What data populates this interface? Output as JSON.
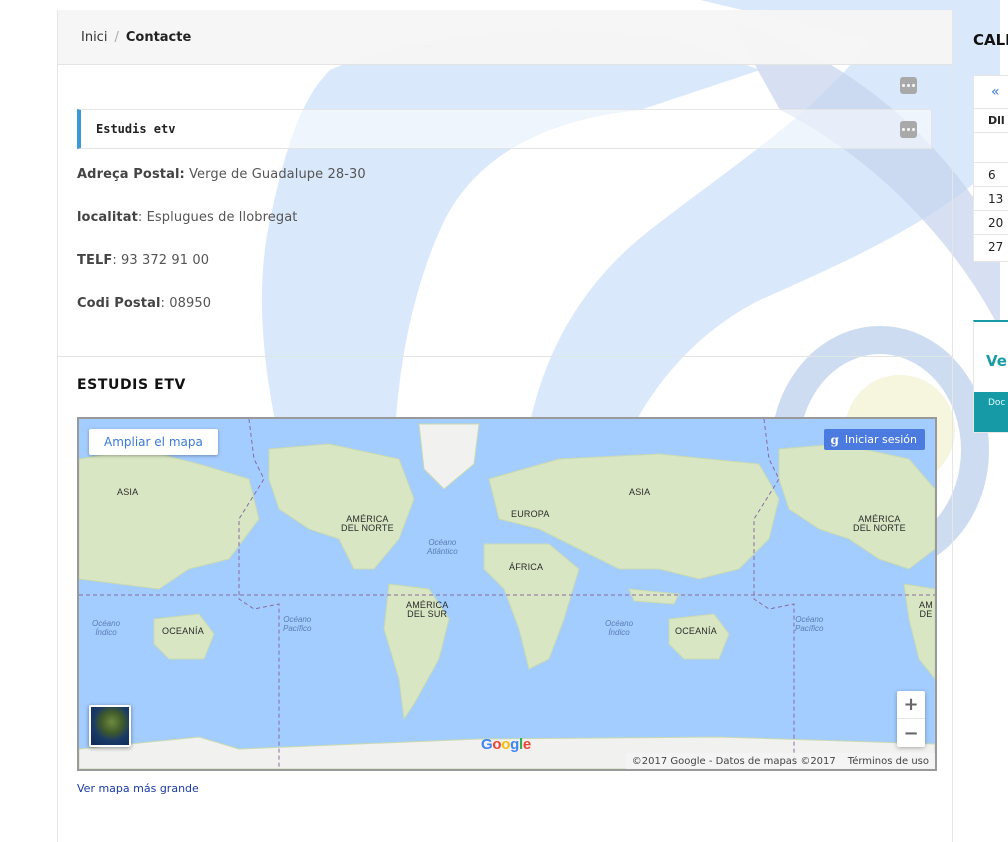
{
  "breadcrumb": {
    "home": "Inici",
    "separator": "/",
    "current": "Contacte"
  },
  "contact": {
    "name": "Estudis etv",
    "address_label": "Adreça Postal:",
    "address_value": "Verge de Guadalupe 28-30",
    "city_label": "localitat",
    "city_value": ": Esplugues de llobregat",
    "phone_label": "TELF",
    "phone_value": ": 93 372 91 00",
    "postal_label": "Codi Postal",
    "postal_value": ": 08950"
  },
  "section_title": "ESTUDIS ETV",
  "map": {
    "enlarge_button": "Ampliar el mapa",
    "signin_icon": "g",
    "signin_button": "Iniciar sesión",
    "zoom_in": "+",
    "zoom_out": "−",
    "google_logo": [
      "G",
      "o",
      "o",
      "g",
      "l",
      "e"
    ],
    "google_colors": [
      "#4285F4",
      "#EA4335",
      "#FBBC05",
      "#4285F4",
      "#34A853",
      "#EA4335"
    ],
    "attribution": "©2017 Google - Datos de mapas ©2017",
    "terms": "Términos de uso",
    "labels": {
      "asia_left": "ASIA",
      "na_left_1": "AMÉRICA",
      "na_left_2": "DEL NORTE",
      "europa": "EUROPA",
      "asia_center": "ASIA",
      "na_right_1": "AMÉRICA",
      "na_right_2": "DEL NORTE",
      "oceano_atlantico_1": "Océano",
      "oceano_atlantico_2": "Atlántico",
      "africa": "ÁFRICA",
      "sa_1": "AMÉRICA",
      "sa_2": "DEL SUR",
      "oceania_left": "OCEANÍA",
      "oceania_right": "OCEANÍA",
      "oceano_indico_l1": "Océano",
      "oceano_indico_l2": "Índico",
      "oceano_pacifico_l1": "Océano",
      "oceano_pacifico_l2": "Pacífico",
      "oceano_indico_r1": "Océano",
      "oceano_indico_r2": "Índico",
      "oceano_pacifico_r1": "Océano",
      "oceano_pacifico_r2": "Pacífico",
      "edge_right_1": "AM",
      "edge_right_2": "DE"
    }
  },
  "map_link": "Ver mapa más grande",
  "sidebar": {
    "calendar_title": "CALE",
    "calendar_prev": "«",
    "calendar_header": "Dll",
    "calendar_days": [
      "6",
      "13",
      "20",
      "27"
    ],
    "ver_text": "Ver",
    "doc_text": "Doc"
  },
  "colors": {
    "accent_blue": "#3a9ad9",
    "teal": "#169aa6",
    "map_water": "#a3ccff",
    "signin_blue": "#4c7be0",
    "link": "#1a3aa6"
  }
}
